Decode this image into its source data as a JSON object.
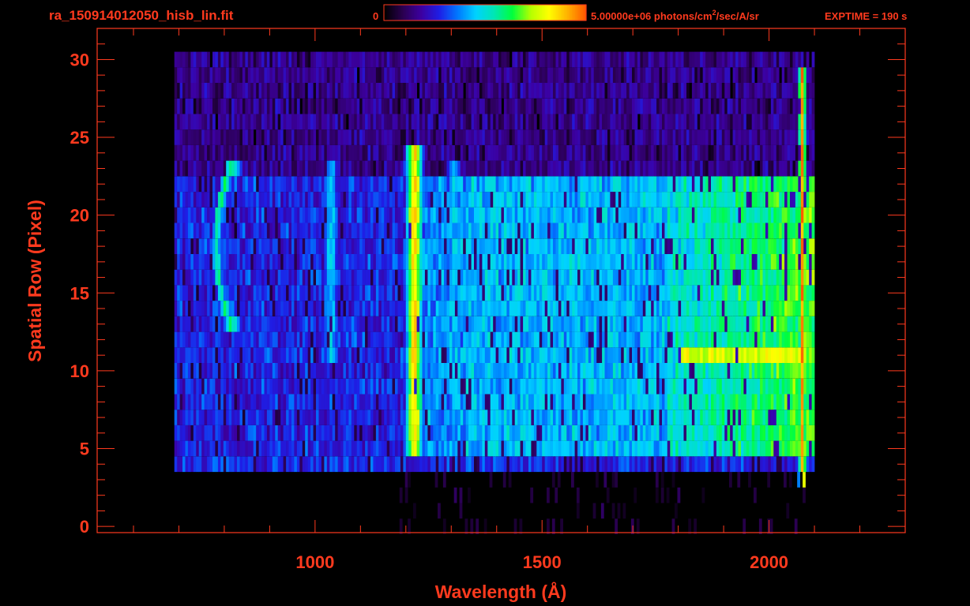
{
  "header": {
    "filename": "ra_150914012050_hisb_lin.fit",
    "colorbar_min": "0",
    "colorbar_max_value": "5.00000e+06 photons/cm",
    "colorbar_units_sup": "2",
    "colorbar_units_rest": "/sec/A/sr",
    "exptime": "EXPTIME = 190 s"
  },
  "colors": {
    "axis": "#ff3a1e",
    "background": "#000000",
    "colormap": [
      "#000000",
      "#2a0050",
      "#3c00a0",
      "#1e1ee6",
      "#0078ff",
      "#00d2ff",
      "#00e6b4",
      "#00ff3c",
      "#b4ff00",
      "#ffff00",
      "#ffb400",
      "#ff5a00"
    ]
  },
  "chart_data": {
    "type": "heatmap",
    "xlabel": "Wavelength (Å)",
    "ylabel": "Spatial Row (Pixel)",
    "xlim": [
      520,
      2300
    ],
    "ylim": [
      -0.4,
      32.0
    ],
    "xticks": [
      1000,
      1500,
      2000
    ],
    "xtick_labels": [
      "1000",
      "1500",
      "2000"
    ],
    "yticks": [
      0,
      5,
      10,
      15,
      20,
      25,
      30
    ],
    "ytick_labels": [
      "0",
      "5",
      "10",
      "15",
      "20",
      "25",
      "30"
    ],
    "x_minor_step": 100,
    "y_minor_step": 1,
    "colorbar_range": [
      0,
      5000000
    ],
    "grid": false,
    "data_x_range": [
      690,
      2100
    ],
    "rows": 31,
    "features": [
      {
        "kind": "emission-line",
        "x": 1216,
        "rows": [
          5,
          24
        ],
        "level": 0.85
      },
      {
        "kind": "emission-line",
        "x": 1304,
        "rows": [
          7,
          23
        ],
        "level": 0.45
      },
      {
        "kind": "emission-line",
        "x": 1032,
        "rows": [
          11,
          23
        ],
        "level": 0.45
      },
      {
        "kind": "emission-line",
        "x": 2070,
        "rows": [
          3,
          29
        ],
        "level": 0.95
      },
      {
        "kind": "continuum-band",
        "x": [
          1800,
          2080
        ],
        "rows": [
          11,
          11
        ],
        "level": 0.78
      },
      {
        "kind": "arc",
        "x": [
          780,
          930
        ],
        "rows": [
          13,
          23
        ],
        "level": 0.6
      }
    ]
  }
}
